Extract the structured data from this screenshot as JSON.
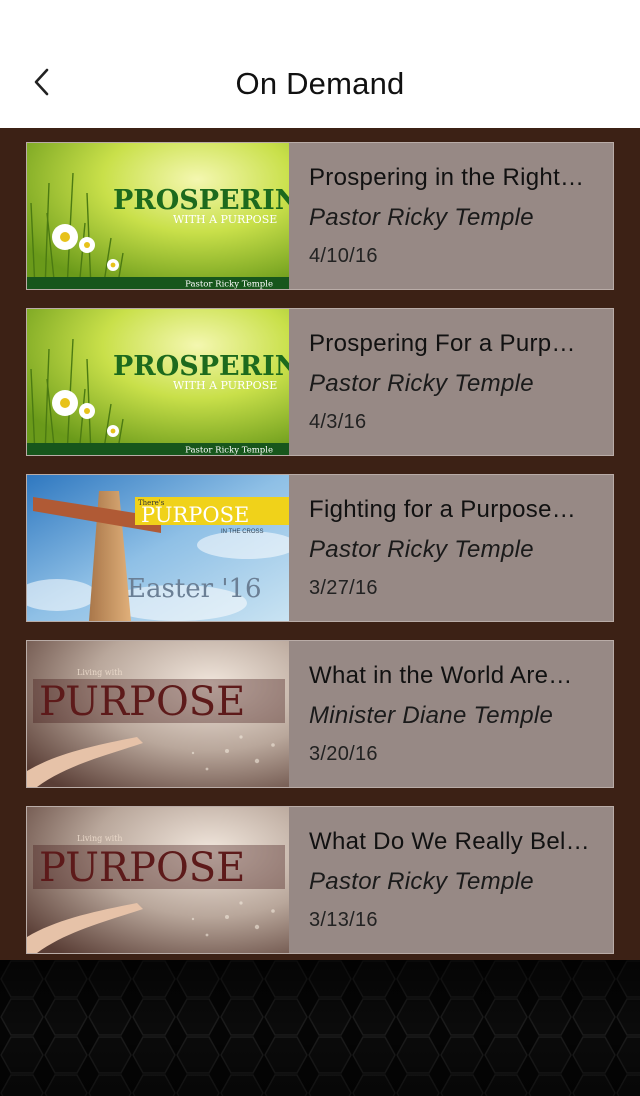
{
  "header": {
    "title": "On Demand",
    "back_icon": "chevron-left-icon"
  },
  "colors": {
    "list_background": "#3c2115",
    "row_background": "#978985",
    "footer_background": "#050505"
  },
  "items": [
    {
      "title": "Prospering in the Right…",
      "speaker": "Pastor Ricky Temple",
      "date": "4/10/16",
      "art": {
        "headline": "PROSPERING",
        "tagline": "WITH A PURPOSE",
        "credit": "Pastor Ricky Temple"
      }
    },
    {
      "title": "Prospering For a Purp…",
      "speaker": "Pastor Ricky Temple",
      "date": "4/3/16",
      "art": {
        "headline": "PROSPERING",
        "tagline": "WITH A PURPOSE",
        "credit": "Pastor Ricky Temple"
      }
    },
    {
      "title": "Fighting for a Purpose…",
      "speaker": "Pastor Ricky Temple",
      "date": "3/27/16",
      "art": {
        "pretitle": "There's",
        "headline": "PURPOSE",
        "tagline": "IN THE CROSS",
        "footer_text": "Easter '16"
      }
    },
    {
      "title": "What in the World Are…",
      "speaker": "Minister Diane Temple",
      "date": "3/20/16",
      "art": {
        "pretitle": "Living with",
        "headline": "PURPOSE"
      }
    },
    {
      "title": "What Do We Really Bel…",
      "speaker": "Pastor Ricky Temple",
      "date": "3/13/16",
      "art": {
        "pretitle": "Living with",
        "headline": "PURPOSE"
      }
    }
  ]
}
